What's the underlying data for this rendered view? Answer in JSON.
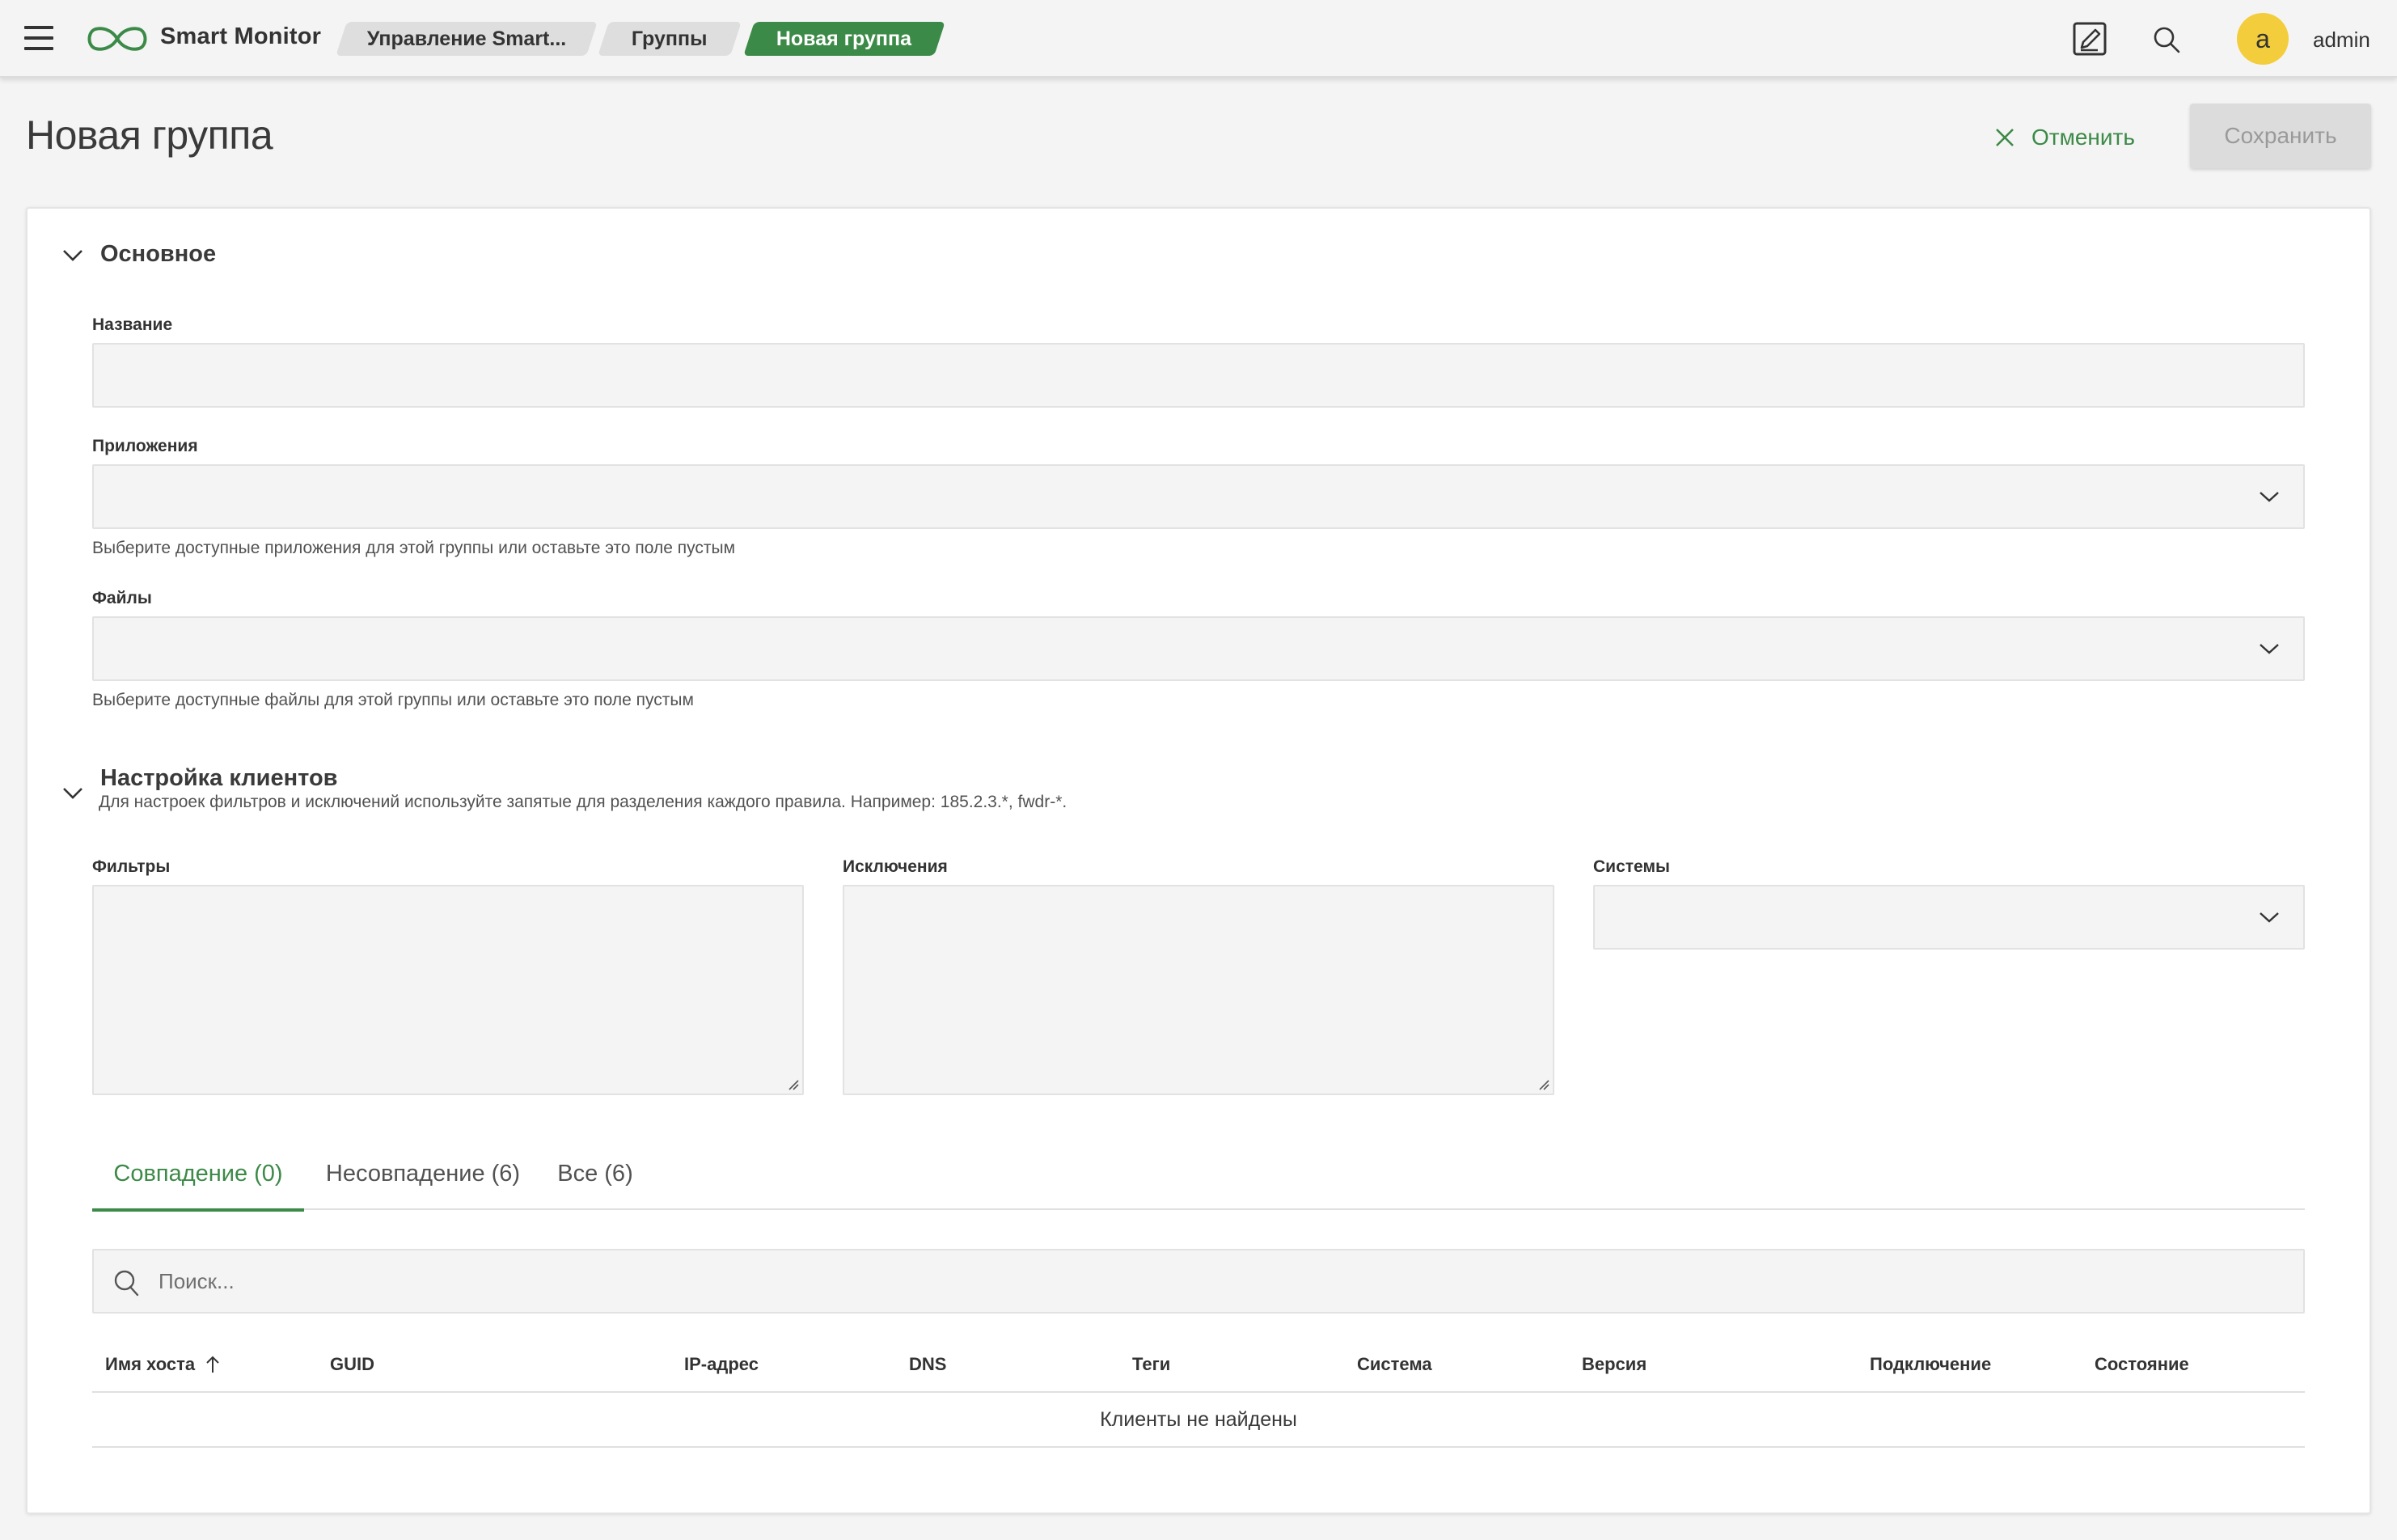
{
  "app": {
    "brand": "Smart Monitor",
    "user": "admin",
    "avatar_letter": "a",
    "accent_color": "#3c8a47"
  },
  "breadcrumbs": [
    "Управление Smart...",
    "Группы",
    "Новая группа"
  ],
  "page": {
    "title": "Новая группа",
    "cancel_label": "Отменить",
    "save_label": "Сохранить"
  },
  "sections": {
    "main": {
      "title": "Основное",
      "name_label": "Название",
      "name_value": "",
      "apps_label": "Приложения",
      "apps_value": "",
      "apps_hint": "Выберите доступные приложения для этой группы или оставьте это поле пустым",
      "files_label": "Файлы",
      "files_value": "",
      "files_hint": "Выберите доступные файлы для этой группы или оставьте это поле пустым"
    },
    "clients": {
      "title": "Настройка клиентов",
      "hint": "Для настроек фильтров и исключений используйте запятые для разделения каждого правила. Например: 185.2.3.*, fwdr-*.",
      "filters_label": "Фильтры",
      "exclusions_label": "Исключения",
      "systems_label": "Системы"
    }
  },
  "tabs": [
    {
      "label": "Совпадение (0)",
      "active": true
    },
    {
      "label": "Несовпадение (6)",
      "active": false
    },
    {
      "label": "Все (6)",
      "active": false
    }
  ],
  "search": {
    "placeholder": "Поиск..."
  },
  "table": {
    "columns": [
      "Имя хоста",
      "GUID",
      "IP-адрес",
      "DNS",
      "Теги",
      "Система",
      "Версия",
      "Подключение",
      "Состояние"
    ],
    "sort_column": "Имя хоста",
    "sort_direction": "asc",
    "empty_text": "Клиенты не найдены"
  },
  "icons": {
    "menu": "hamburger-icon",
    "logo": "infinity-logo-icon",
    "notes": "edit-note-icon",
    "search": "search-icon",
    "cancel": "close-icon",
    "collapse": "chevron-down-icon",
    "sort": "arrow-up-icon"
  }
}
